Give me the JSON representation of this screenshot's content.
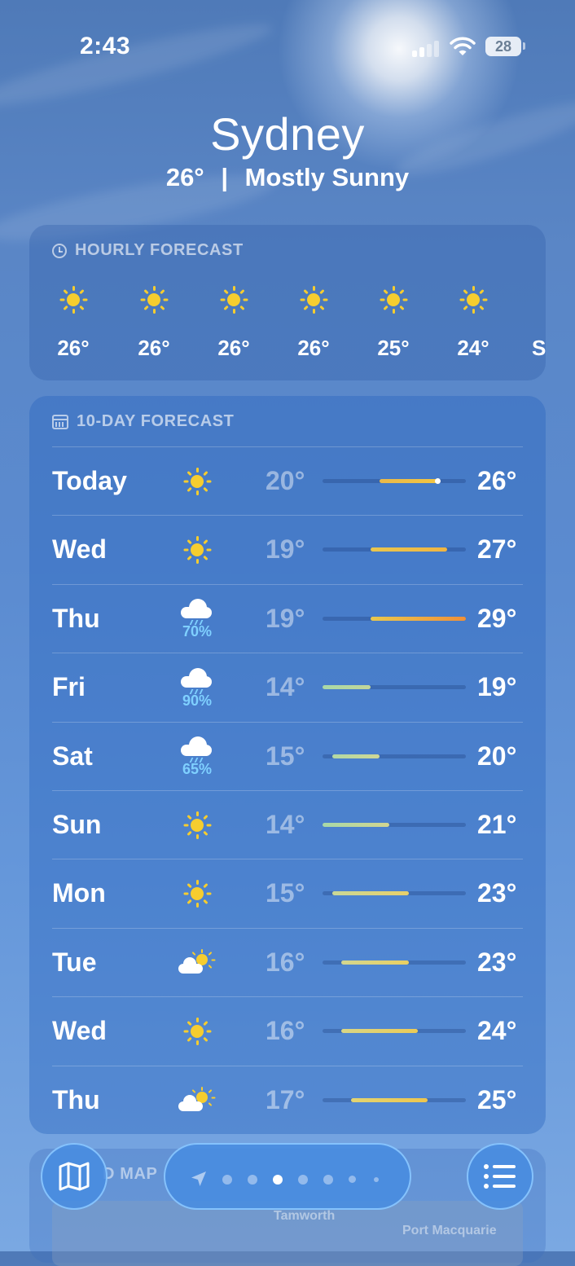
{
  "status_bar": {
    "time": "2:43",
    "battery": "28",
    "icons": [
      "cellular-signal-icon",
      "wifi-icon",
      "battery-icon"
    ]
  },
  "location": {
    "city": "Sydney",
    "current_temp": "26°",
    "separator": "|",
    "condition": "Mostly Sunny"
  },
  "hourly": {
    "header": "HOURLY FORECAST",
    "header_icon": "clock-icon",
    "items": [
      {
        "icon": "sun-icon",
        "temp": "26°"
      },
      {
        "icon": "sun-icon",
        "temp": "26°"
      },
      {
        "icon": "sun-icon",
        "temp": "26°"
      },
      {
        "icon": "sun-icon",
        "temp": "26°"
      },
      {
        "icon": "sun-icon",
        "temp": "25°"
      },
      {
        "icon": "sun-icon",
        "temp": "24°"
      },
      {
        "icon": "sunset-icon",
        "temp": "S"
      }
    ]
  },
  "daily": {
    "header": "10-DAY FORECAST",
    "header_icon": "calendar-icon",
    "range_min": 14,
    "range_max": 29,
    "days": [
      {
        "day": "Today",
        "icon": "sun-icon",
        "precip": "",
        "low": "20°",
        "high": "26°",
        "low_val": 20,
        "high_val": 26,
        "current_val": 26,
        "colors": [
          "#eab94a",
          "#f2c542"
        ]
      },
      {
        "day": "Wed",
        "icon": "sun-icon",
        "precip": "",
        "low": "19°",
        "high": "27°",
        "low_val": 19,
        "high_val": 27,
        "colors": [
          "#e9c64e",
          "#f0b542"
        ]
      },
      {
        "day": "Thu",
        "icon": "rain-cloud-icon",
        "precip": "70%",
        "low": "19°",
        "high": "29°",
        "low_val": 19,
        "high_val": 29,
        "colors": [
          "#eac84e",
          "#f09038"
        ]
      },
      {
        "day": "Fri",
        "icon": "rain-cloud-icon",
        "precip": "90%",
        "low": "14°",
        "high": "19°",
        "low_val": 14,
        "high_val": 19,
        "colors": [
          "#a8d8a8",
          "#c2d69a"
        ]
      },
      {
        "day": "Sat",
        "icon": "rain-cloud-icon",
        "precip": "65%",
        "low": "15°",
        "high": "20°",
        "low_val": 15,
        "high_val": 20,
        "colors": [
          "#b2d9a4",
          "#cfd795"
        ]
      },
      {
        "day": "Sun",
        "icon": "sun-icon",
        "precip": "",
        "low": "14°",
        "high": "21°",
        "low_val": 14,
        "high_val": 21,
        "colors": [
          "#a8d8a8",
          "#d2d690"
        ]
      },
      {
        "day": "Mon",
        "icon": "sun-icon",
        "precip": "",
        "low": "15°",
        "high": "23°",
        "low_val": 15,
        "high_val": 23,
        "colors": [
          "#c9d897",
          "#e8d06a"
        ]
      },
      {
        "day": "Tue",
        "icon": "partly-cloudy-icon",
        "precip": "",
        "low": "16°",
        "high": "23°",
        "low_val": 16,
        "high_val": 23,
        "colors": [
          "#d2d690",
          "#ead062"
        ]
      },
      {
        "day": "Wed",
        "icon": "sun-icon",
        "precip": "",
        "low": "16°",
        "high": "24°",
        "low_val": 16,
        "high_val": 24,
        "colors": [
          "#d9d685",
          "#eccb56"
        ]
      },
      {
        "day": "Thu",
        "icon": "partly-cloudy-icon",
        "precip": "",
        "low": "17°",
        "high": "25°",
        "low_val": 17,
        "high_val": 25,
        "colors": [
          "#e2d472",
          "#eec64e"
        ]
      }
    ]
  },
  "map_preview": {
    "header": "D MAP",
    "labels": [
      "Tamworth",
      "Port Macquarie"
    ]
  },
  "bottom_bar": {
    "map_button_icon": "map-icon",
    "list_button_icon": "list-icon",
    "location_arrow_icon": "location-arrow-icon",
    "page_count": 7,
    "active_page": 2
  }
}
